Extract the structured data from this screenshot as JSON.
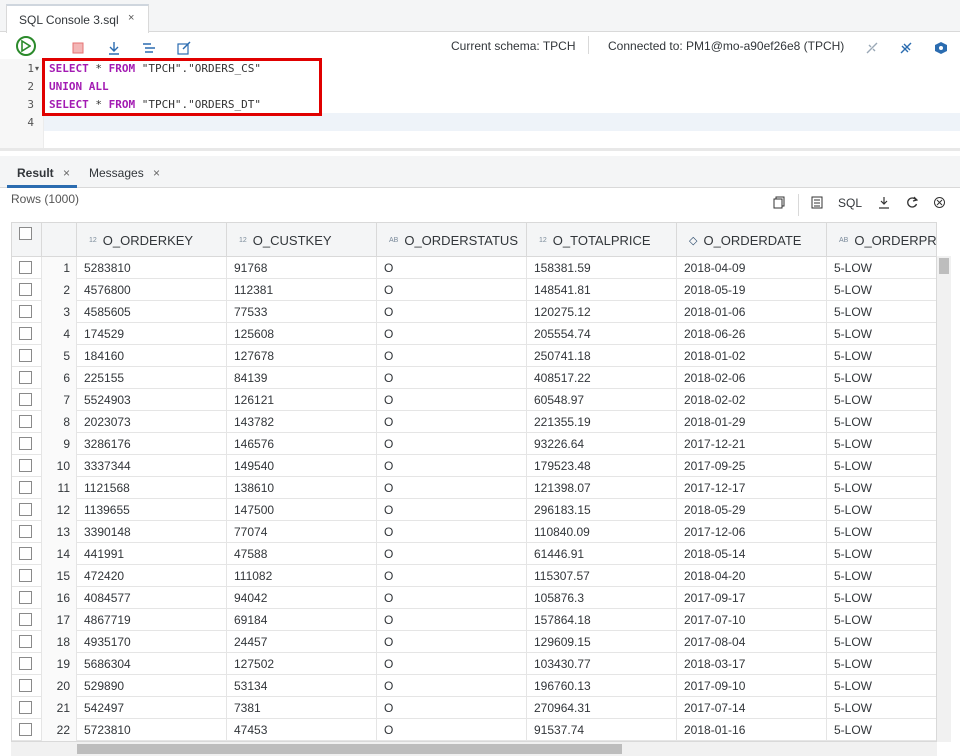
{
  "tab": {
    "title": "SQL Console 3.sql",
    "close": "×"
  },
  "toolbar": {
    "current_schema": "Current schema: TPCH",
    "connected_to": "Connected to: PM1@mo-a90ef26e8 (TPCH)"
  },
  "editor": {
    "lines": [
      {
        "num": "1",
        "kw1": "SELECT",
        "rest1": " * ",
        "kw2": "FROM",
        "rest2": " \"TPCH\".\"ORDERS_CS\""
      },
      {
        "num": "2",
        "kw1": "UNION ALL",
        "rest1": "",
        "kw2": "",
        "rest2": ""
      },
      {
        "num": "3",
        "kw1": "SELECT",
        "rest1": " * ",
        "kw2": "FROM",
        "rest2": " \"TPCH\".\"ORDERS_DT\""
      },
      {
        "num": "4",
        "kw1": "",
        "rest1": "",
        "kw2": "",
        "rest2": ""
      }
    ]
  },
  "result_tabs": {
    "result": "Result",
    "messages": "Messages",
    "close": "×"
  },
  "result_toolbar": {
    "rows": "Rows (1000)",
    "sql": "SQL"
  },
  "columns": [
    {
      "type": "12",
      "name": "O_ORDERKEY"
    },
    {
      "type": "12",
      "name": "O_CUSTKEY"
    },
    {
      "type": "AB",
      "name": "O_ORDERSTATUS"
    },
    {
      "type": "12",
      "name": "O_TOTALPRICE"
    },
    {
      "type": "◇",
      "name": "O_ORDERDATE"
    },
    {
      "type": "AB",
      "name": "O_ORDERPRI"
    }
  ],
  "rows": [
    [
      "1",
      "5283810",
      "91768",
      "O",
      "158381.59",
      "2018-04-09",
      "5-LOW"
    ],
    [
      "2",
      "4576800",
      "112381",
      "O",
      "148541.81",
      "2018-05-19",
      "5-LOW"
    ],
    [
      "3",
      "4585605",
      "77533",
      "O",
      "120275.12",
      "2018-01-06",
      "5-LOW"
    ],
    [
      "4",
      "174529",
      "125608",
      "O",
      "205554.74",
      "2018-06-26",
      "5-LOW"
    ],
    [
      "5",
      "184160",
      "127678",
      "O",
      "250741.18",
      "2018-01-02",
      "5-LOW"
    ],
    [
      "6",
      "225155",
      "84139",
      "O",
      "408517.22",
      "2018-02-06",
      "5-LOW"
    ],
    [
      "7",
      "5524903",
      "126121",
      "O",
      "60548.97",
      "2018-02-02",
      "5-LOW"
    ],
    [
      "8",
      "2023073",
      "143782",
      "O",
      "221355.19",
      "2018-01-29",
      "5-LOW"
    ],
    [
      "9",
      "3286176",
      "146576",
      "O",
      "93226.64",
      "2017-12-21",
      "5-LOW"
    ],
    [
      "10",
      "3337344",
      "149540",
      "O",
      "179523.48",
      "2017-09-25",
      "5-LOW"
    ],
    [
      "11",
      "1121568",
      "138610",
      "O",
      "121398.07",
      "2017-12-17",
      "5-LOW"
    ],
    [
      "12",
      "1139655",
      "147500",
      "O",
      "296183.15",
      "2018-05-29",
      "5-LOW"
    ],
    [
      "13",
      "3390148",
      "77074",
      "O",
      "110840.09",
      "2017-12-06",
      "5-LOW"
    ],
    [
      "14",
      "441991",
      "47588",
      "O",
      "61446.91",
      "2018-05-14",
      "5-LOW"
    ],
    [
      "15",
      "472420",
      "111082",
      "O",
      "115307.57",
      "2018-04-20",
      "5-LOW"
    ],
    [
      "16",
      "4084577",
      "94042",
      "O",
      "105876.3",
      "2017-09-17",
      "5-LOW"
    ],
    [
      "17",
      "4867719",
      "69184",
      "O",
      "157864.18",
      "2017-07-10",
      "5-LOW"
    ],
    [
      "18",
      "4935170",
      "24457",
      "O",
      "129609.15",
      "2017-08-04",
      "5-LOW"
    ],
    [
      "19",
      "5686304",
      "127502",
      "O",
      "103430.77",
      "2018-03-17",
      "5-LOW"
    ],
    [
      "20",
      "529890",
      "53134",
      "O",
      "196760.13",
      "2017-09-10",
      "5-LOW"
    ],
    [
      "21",
      "542497",
      "7381",
      "O",
      "270964.31",
      "2017-07-14",
      "5-LOW"
    ],
    [
      "22",
      "5723810",
      "47453",
      "O",
      "91537.74",
      "2018-01-16",
      "5-LOW"
    ]
  ]
}
